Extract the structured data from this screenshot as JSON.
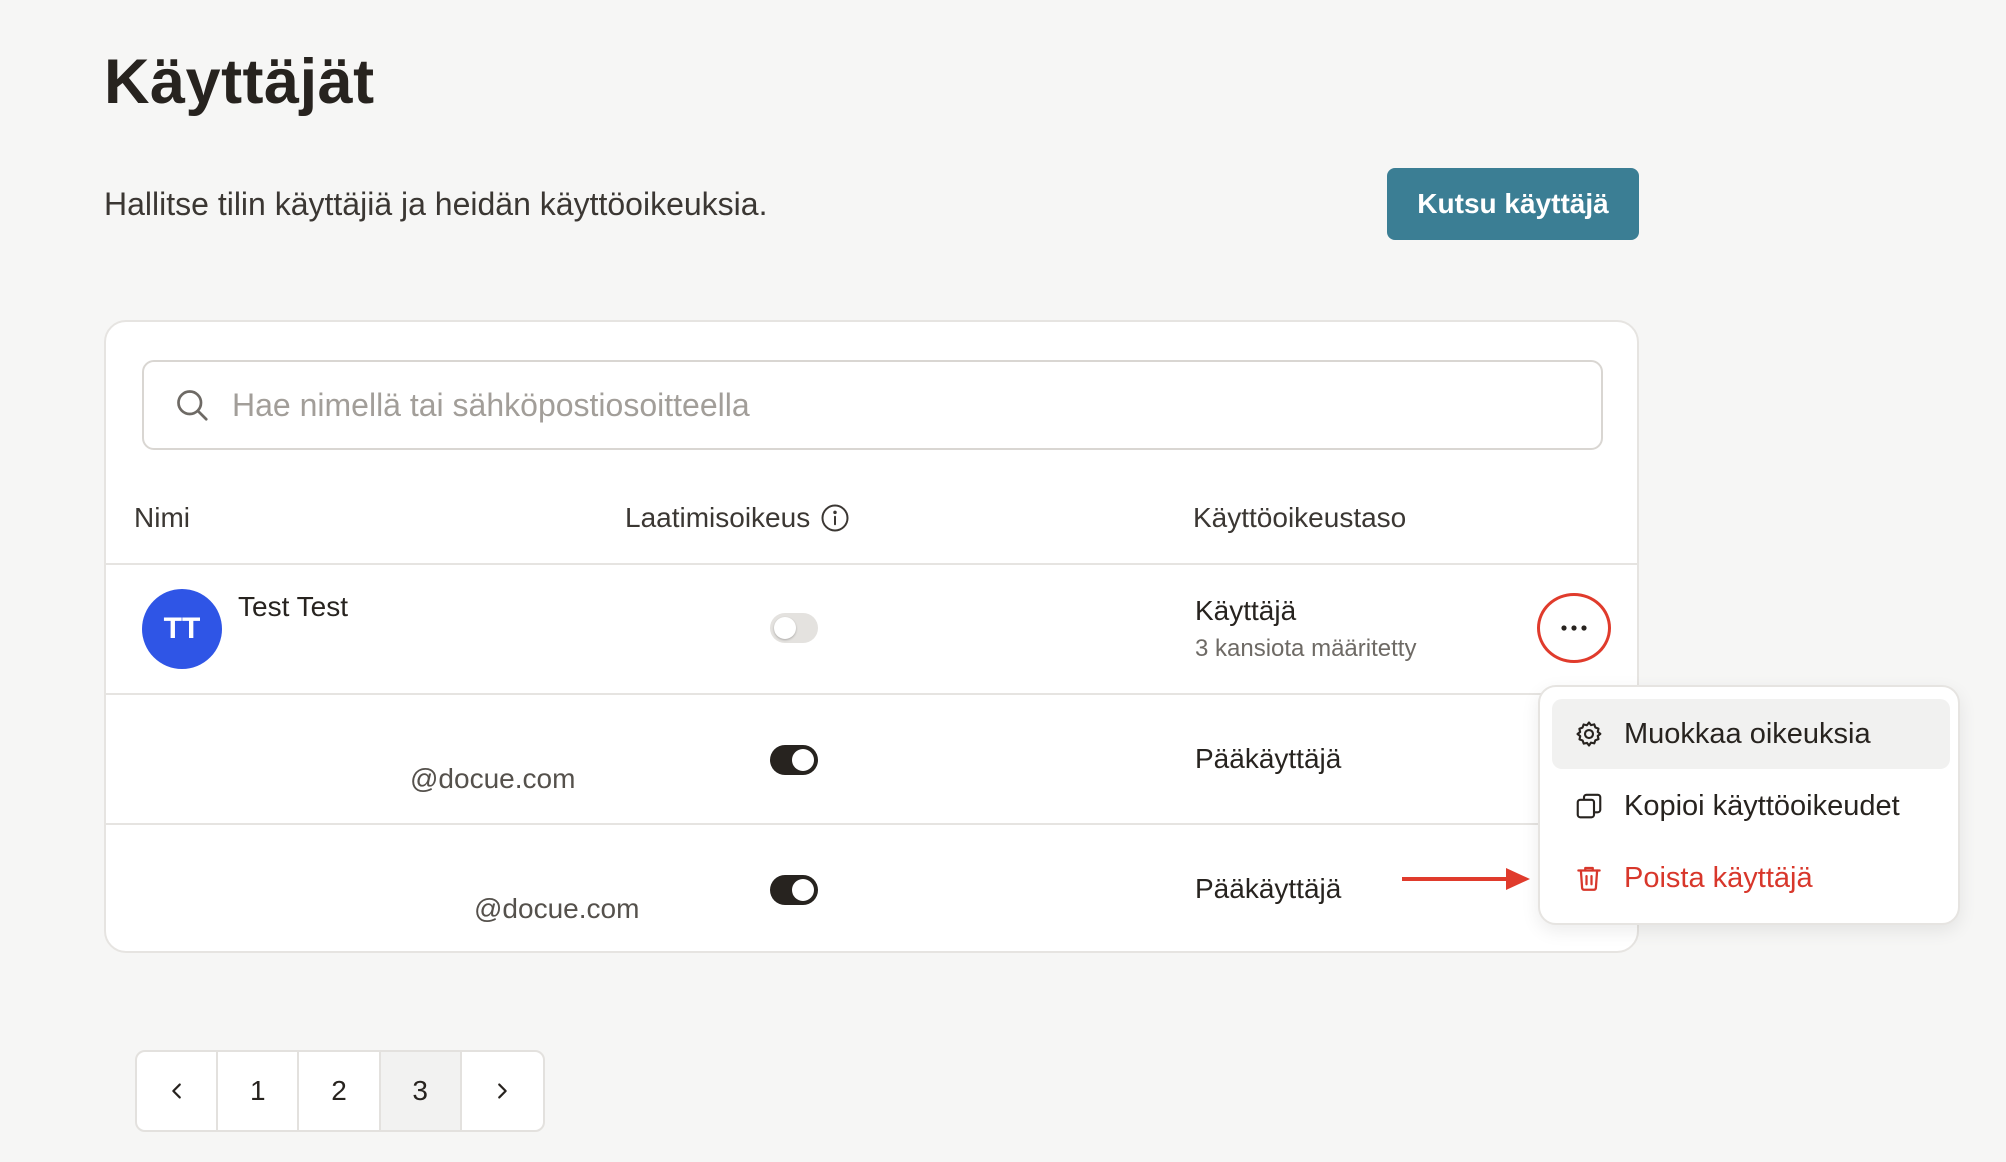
{
  "page": {
    "title": "Käyttäjät",
    "subtitle": "Hallitse tilin käyttäjiä ja heidän käyttöoikeuksia.",
    "invite_button": "Kutsu käyttäjä"
  },
  "search": {
    "placeholder": "Hae nimellä tai sähköpostiosoitteella",
    "value": ""
  },
  "table": {
    "headers": [
      "Nimi",
      "Laatimisoikeus",
      "Käyttöoikeustaso"
    ],
    "rows": [
      {
        "initials": "TT",
        "name": "Test Test",
        "email": "",
        "can_create": false,
        "role": "Käyttäjä",
        "role_detail": "3 kansiota määritetty"
      },
      {
        "initials": "",
        "name": "",
        "email": "@docue.com",
        "can_create": true,
        "role": "Pääkäyttäjä",
        "role_detail": ""
      },
      {
        "initials": "",
        "name": "",
        "email": "@docue.com",
        "can_create": true,
        "role": "Pääkäyttäjä",
        "role_detail": ""
      }
    ]
  },
  "row_menu": {
    "items": [
      {
        "label": "Muokkaa oikeuksia",
        "icon": "gear-icon"
      },
      {
        "label": "Kopioi käyttöoikeudet",
        "icon": "copy-icon"
      },
      {
        "label": "Poista käyttäjä",
        "icon": "trash-icon"
      }
    ]
  },
  "pagination": {
    "pages": [
      "1",
      "2",
      "3"
    ],
    "current": "3"
  },
  "colors": {
    "accent": "#3b7e94",
    "avatar": "#2f55e6",
    "danger": "#d8372b",
    "highlight": "#e03b2c"
  }
}
